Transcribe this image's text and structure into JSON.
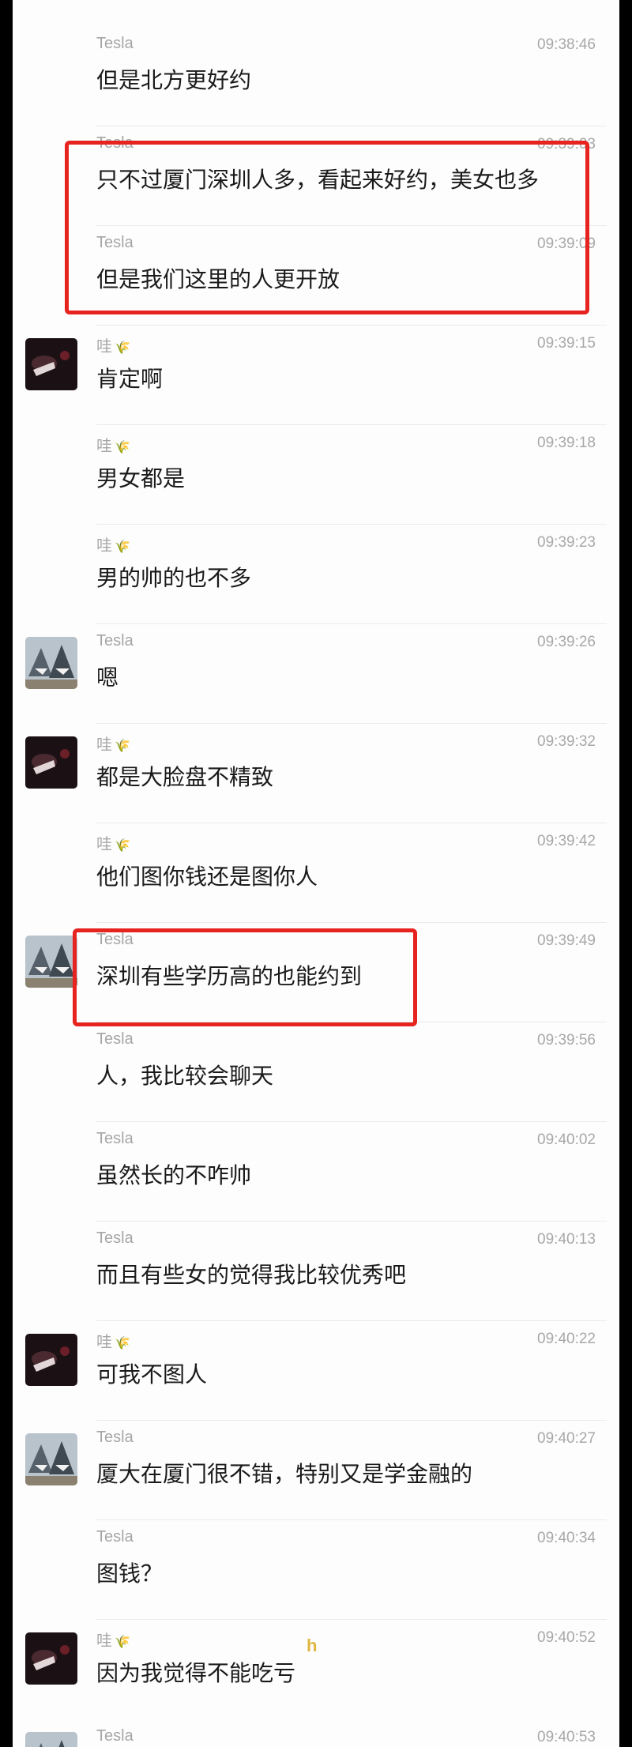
{
  "messages": [
    {
      "sender": "Tesla",
      "time": "09:38:46",
      "text": "但是北方更好约",
      "avatar": ""
    },
    {
      "sender": "Tesla",
      "time": "09:39:03",
      "text": "只不过厦门深圳人多，看起来好约，美女也多",
      "avatar": ""
    },
    {
      "sender": "Tesla",
      "time": "09:39:09",
      "text": "但是我们这里的人更开放",
      "avatar": ""
    },
    {
      "sender": "哇",
      "time": "09:39:15",
      "text": "肯定啊",
      "avatar": "dark"
    },
    {
      "sender": "哇",
      "time": "09:39:18",
      "text": "男女都是",
      "avatar": ""
    },
    {
      "sender": "哇",
      "time": "09:39:23",
      "text": "男的帅的也不多",
      "avatar": ""
    },
    {
      "sender": "Tesla",
      "time": "09:39:26",
      "text": "嗯",
      "avatar": "shark"
    },
    {
      "sender": "哇",
      "time": "09:39:32",
      "text": "都是大脸盘不精致",
      "avatar": "dark"
    },
    {
      "sender": "哇",
      "time": "09:39:42",
      "text": "他们图你钱还是图你人",
      "avatar": ""
    },
    {
      "sender": "Tesla",
      "time": "09:39:49",
      "text": "深圳有些学历高的也能约到",
      "avatar": "shark"
    },
    {
      "sender": "Tesla",
      "time": "09:39:56",
      "text": "人，我比较会聊天",
      "avatar": ""
    },
    {
      "sender": "Tesla",
      "time": "09:40:02",
      "text": "虽然长的不咋帅",
      "avatar": ""
    },
    {
      "sender": "Tesla",
      "time": "09:40:13",
      "text": "而且有些女的觉得我比较优秀吧",
      "avatar": ""
    },
    {
      "sender": "哇",
      "time": "09:40:22",
      "text": "可我不图人",
      "avatar": "dark"
    },
    {
      "sender": "Tesla",
      "time": "09:40:27",
      "text": "厦大在厦门很不错，特别又是学金融的",
      "avatar": "shark"
    },
    {
      "sender": "Tesla",
      "time": "09:40:34",
      "text": "图钱？",
      "avatar": ""
    },
    {
      "sender": "哇",
      "time": "09:40:52",
      "text": "因为我觉得不能吃亏",
      "avatar": "dark"
    },
    {
      "sender": "Tesla",
      "time": "09:40:53",
      "text": "",
      "avatar": "shark"
    }
  ],
  "watermark": "h"
}
